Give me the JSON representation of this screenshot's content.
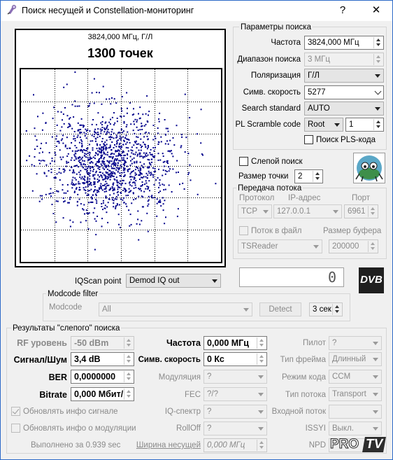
{
  "window": {
    "title": "Поиск несущей и Constellation-мониторинг",
    "help_label": "?",
    "close_label": "✕"
  },
  "plot": {
    "freq_label": "3824,000 МГц, Г/Л",
    "points_label": "1300 точек",
    "points_color": "#00008b"
  },
  "search_params": {
    "title": "Параметры поиска",
    "frequency_label": "Частота",
    "frequency_value": "3824,000 МГц",
    "range_label": "Диапазон поиска",
    "range_value": "3 МГц",
    "polarization_label": "Поляризация",
    "polarization_value": "Г/Л",
    "symrate_label": "Симв. скорость",
    "symrate_value": "5277",
    "standard_label": "Search standard",
    "standard_value": "AUTO",
    "pl_label": "PL Scramble code",
    "pl_mode_value": "Root",
    "pl_code_value": "1",
    "pls_search_label": "Поиск PLS-кода"
  },
  "blind": {
    "blind_search_label": "Слепой поиск",
    "point_size_label": "Размер точки",
    "point_size_value": "2"
  },
  "stream": {
    "title": "Передача потока",
    "protocol_header": "Протокол",
    "ip_header": "IP-адрес",
    "port_header": "Порт",
    "protocol_value": "TCP",
    "ip_value": "127.0.0.1",
    "port_value": "6961",
    "to_file_label": "Поток в файл",
    "buffer_label": "Размер буфера",
    "reader_value": "TSReader",
    "buffer_value": "200000"
  },
  "iq": {
    "scan_point_label": "IQScan point",
    "scan_point_value": "Demod IQ out",
    "counter_value": "0",
    "dvb_logo": "DVB"
  },
  "modcode": {
    "title": "Modcode filter",
    "modcode_label": "Modcode",
    "modcode_value": "All",
    "detect_label": "Detect",
    "timeout_value": "3 сек"
  },
  "results": {
    "title": "Результаты \"слепого\" поиска",
    "rf_label": "RF уровень",
    "rf_value": "-50 dBm",
    "snr_label": "Сигнал/Шум",
    "snr_value": "3,4 dB",
    "ber_label": "BER",
    "ber_value": "0,0000000",
    "bitrate_label": "Bitrate",
    "bitrate_value": "0,000 Мбит/",
    "freq_label": "Частота",
    "freq_value": "0,000 МГц",
    "symrate_label": "Симв. скорость",
    "symrate_value": "0 Кс",
    "mod_label": "Модуляция",
    "mod_value": "?",
    "fec_label": "FEC",
    "fec_value": "?/?",
    "iq_label": "IQ-спектр",
    "iq_value": "?",
    "rolloff_label": "RollOff",
    "rolloff_value": "?",
    "carrier_width_label": "Ширина несущей",
    "carrier_width_value": "0,000 МГц",
    "pilot_label": "Пилот",
    "pilot_value": "?",
    "frame_label": "Тип фрейма",
    "frame_value": "Длинный",
    "code_label": "Режим кода",
    "code_value": "CCM",
    "stream_type_label": "Тип потока",
    "stream_type_value": "Transport",
    "input_stream_label": "Входной поток",
    "input_stream_value": "",
    "issyi_label": "ISSYI",
    "issyi_value": "Выкл.",
    "npd_label": "NPD",
    "npd_value": "",
    "update_signal_label": "Обновлять инфо сигнале",
    "update_mod_label": "Обновлять инфо о модуляции",
    "done_label": "Выполнено за 0.939 sec"
  },
  "watermark": {
    "text_pro": "PRO",
    "text_tv": "TV"
  }
}
